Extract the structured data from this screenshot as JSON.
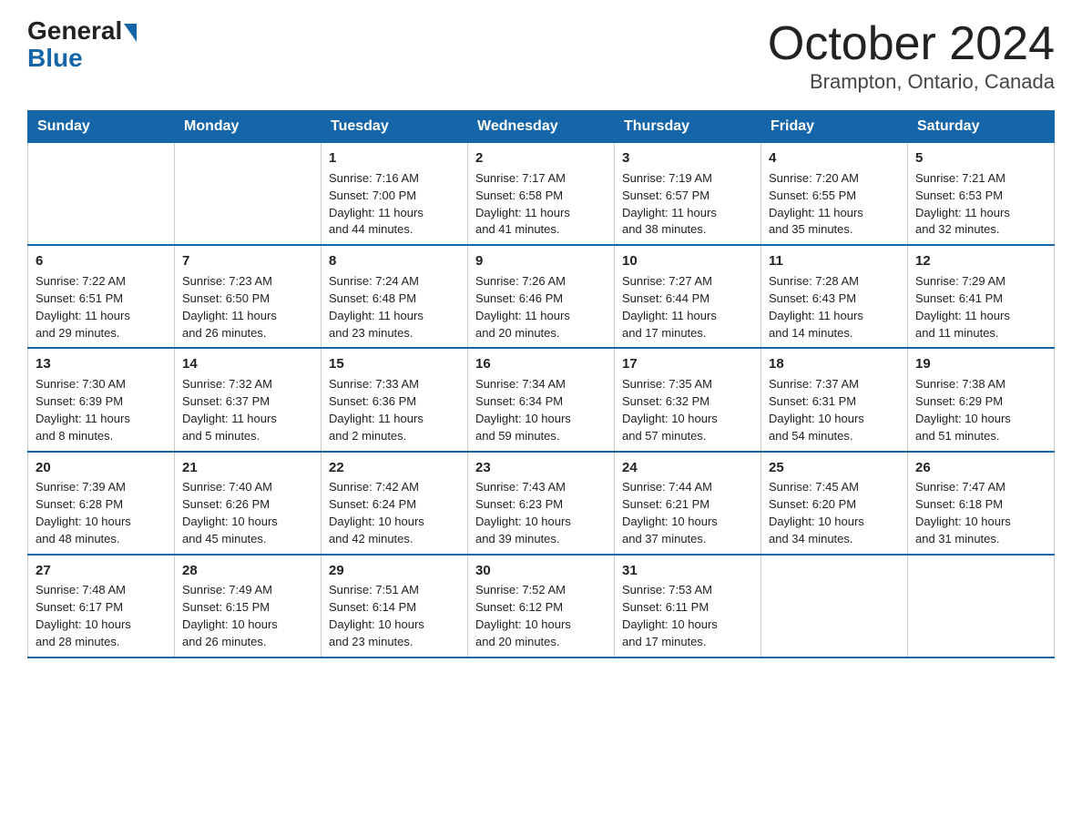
{
  "header": {
    "logo_general": "General",
    "logo_blue": "Blue",
    "month_title": "October 2024",
    "location": "Brampton, Ontario, Canada"
  },
  "days_of_week": [
    "Sunday",
    "Monday",
    "Tuesday",
    "Wednesday",
    "Thursday",
    "Friday",
    "Saturday"
  ],
  "weeks": [
    [
      {
        "day": "",
        "info": ""
      },
      {
        "day": "",
        "info": ""
      },
      {
        "day": "1",
        "info": "Sunrise: 7:16 AM\nSunset: 7:00 PM\nDaylight: 11 hours\nand 44 minutes."
      },
      {
        "day": "2",
        "info": "Sunrise: 7:17 AM\nSunset: 6:58 PM\nDaylight: 11 hours\nand 41 minutes."
      },
      {
        "day": "3",
        "info": "Sunrise: 7:19 AM\nSunset: 6:57 PM\nDaylight: 11 hours\nand 38 minutes."
      },
      {
        "day": "4",
        "info": "Sunrise: 7:20 AM\nSunset: 6:55 PM\nDaylight: 11 hours\nand 35 minutes."
      },
      {
        "day": "5",
        "info": "Sunrise: 7:21 AM\nSunset: 6:53 PM\nDaylight: 11 hours\nand 32 minutes."
      }
    ],
    [
      {
        "day": "6",
        "info": "Sunrise: 7:22 AM\nSunset: 6:51 PM\nDaylight: 11 hours\nand 29 minutes."
      },
      {
        "day": "7",
        "info": "Sunrise: 7:23 AM\nSunset: 6:50 PM\nDaylight: 11 hours\nand 26 minutes."
      },
      {
        "day": "8",
        "info": "Sunrise: 7:24 AM\nSunset: 6:48 PM\nDaylight: 11 hours\nand 23 minutes."
      },
      {
        "day": "9",
        "info": "Sunrise: 7:26 AM\nSunset: 6:46 PM\nDaylight: 11 hours\nand 20 minutes."
      },
      {
        "day": "10",
        "info": "Sunrise: 7:27 AM\nSunset: 6:44 PM\nDaylight: 11 hours\nand 17 minutes."
      },
      {
        "day": "11",
        "info": "Sunrise: 7:28 AM\nSunset: 6:43 PM\nDaylight: 11 hours\nand 14 minutes."
      },
      {
        "day": "12",
        "info": "Sunrise: 7:29 AM\nSunset: 6:41 PM\nDaylight: 11 hours\nand 11 minutes."
      }
    ],
    [
      {
        "day": "13",
        "info": "Sunrise: 7:30 AM\nSunset: 6:39 PM\nDaylight: 11 hours\nand 8 minutes."
      },
      {
        "day": "14",
        "info": "Sunrise: 7:32 AM\nSunset: 6:37 PM\nDaylight: 11 hours\nand 5 minutes."
      },
      {
        "day": "15",
        "info": "Sunrise: 7:33 AM\nSunset: 6:36 PM\nDaylight: 11 hours\nand 2 minutes."
      },
      {
        "day": "16",
        "info": "Sunrise: 7:34 AM\nSunset: 6:34 PM\nDaylight: 10 hours\nand 59 minutes."
      },
      {
        "day": "17",
        "info": "Sunrise: 7:35 AM\nSunset: 6:32 PM\nDaylight: 10 hours\nand 57 minutes."
      },
      {
        "day": "18",
        "info": "Sunrise: 7:37 AM\nSunset: 6:31 PM\nDaylight: 10 hours\nand 54 minutes."
      },
      {
        "day": "19",
        "info": "Sunrise: 7:38 AM\nSunset: 6:29 PM\nDaylight: 10 hours\nand 51 minutes."
      }
    ],
    [
      {
        "day": "20",
        "info": "Sunrise: 7:39 AM\nSunset: 6:28 PM\nDaylight: 10 hours\nand 48 minutes."
      },
      {
        "day": "21",
        "info": "Sunrise: 7:40 AM\nSunset: 6:26 PM\nDaylight: 10 hours\nand 45 minutes."
      },
      {
        "day": "22",
        "info": "Sunrise: 7:42 AM\nSunset: 6:24 PM\nDaylight: 10 hours\nand 42 minutes."
      },
      {
        "day": "23",
        "info": "Sunrise: 7:43 AM\nSunset: 6:23 PM\nDaylight: 10 hours\nand 39 minutes."
      },
      {
        "day": "24",
        "info": "Sunrise: 7:44 AM\nSunset: 6:21 PM\nDaylight: 10 hours\nand 37 minutes."
      },
      {
        "day": "25",
        "info": "Sunrise: 7:45 AM\nSunset: 6:20 PM\nDaylight: 10 hours\nand 34 minutes."
      },
      {
        "day": "26",
        "info": "Sunrise: 7:47 AM\nSunset: 6:18 PM\nDaylight: 10 hours\nand 31 minutes."
      }
    ],
    [
      {
        "day": "27",
        "info": "Sunrise: 7:48 AM\nSunset: 6:17 PM\nDaylight: 10 hours\nand 28 minutes."
      },
      {
        "day": "28",
        "info": "Sunrise: 7:49 AM\nSunset: 6:15 PM\nDaylight: 10 hours\nand 26 minutes."
      },
      {
        "day": "29",
        "info": "Sunrise: 7:51 AM\nSunset: 6:14 PM\nDaylight: 10 hours\nand 23 minutes."
      },
      {
        "day": "30",
        "info": "Sunrise: 7:52 AM\nSunset: 6:12 PM\nDaylight: 10 hours\nand 20 minutes."
      },
      {
        "day": "31",
        "info": "Sunrise: 7:53 AM\nSunset: 6:11 PM\nDaylight: 10 hours\nand 17 minutes."
      },
      {
        "day": "",
        "info": ""
      },
      {
        "day": "",
        "info": ""
      }
    ]
  ]
}
